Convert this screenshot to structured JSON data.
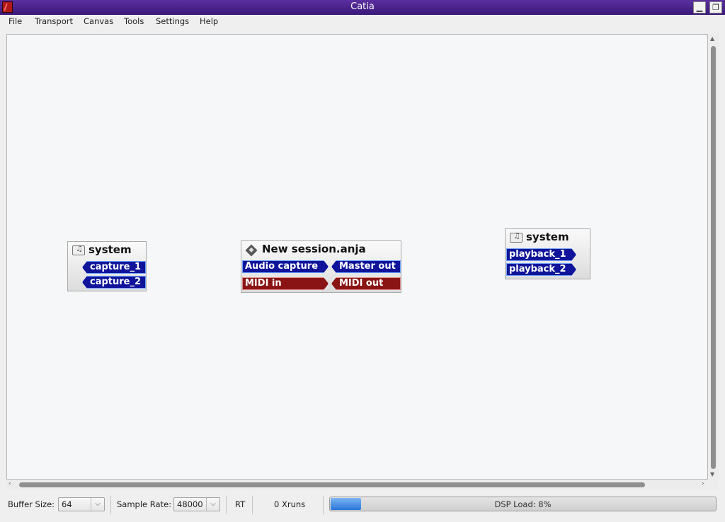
{
  "window": {
    "title": "Catia"
  },
  "menubar": {
    "items": [
      "File",
      "Transport",
      "Canvas",
      "Tools",
      "Settings",
      "Help"
    ]
  },
  "canvas": {
    "nodes": [
      {
        "title": "system",
        "icon": "audio-device-icon",
        "ports": [
          {
            "label": "capture_1",
            "type": "audio"
          },
          {
            "label": "capture_2",
            "type": "audio"
          }
        ]
      },
      {
        "title": "New session.anja",
        "icon": "session-icon",
        "ports": [
          {
            "label": "Audio capture",
            "type": "audio"
          },
          {
            "label": "Master out",
            "type": "audio"
          },
          {
            "label": "MIDI in",
            "type": "midi"
          },
          {
            "label": "MIDI out",
            "type": "midi"
          }
        ]
      },
      {
        "title": "system",
        "icon": "audio-device-icon",
        "ports": [
          {
            "label": "playback_1",
            "type": "audio"
          },
          {
            "label": "playback_2",
            "type": "audio"
          }
        ]
      }
    ]
  },
  "statusbar": {
    "buffer_size_label": "Buffer Size:",
    "buffer_size_value": "64",
    "sample_rate_label": "Sample Rate:",
    "sample_rate_value": "48000",
    "rt_label": "RT",
    "xruns": "0 Xruns",
    "dsp_load_text": "DSP Load: 8%",
    "dsp_load_percent": 8
  },
  "colors": {
    "audio_port": "#0f149a",
    "midi_port": "#8a1414",
    "titlebar": "#4a2490",
    "dsp_fill": "#2a76d8"
  }
}
